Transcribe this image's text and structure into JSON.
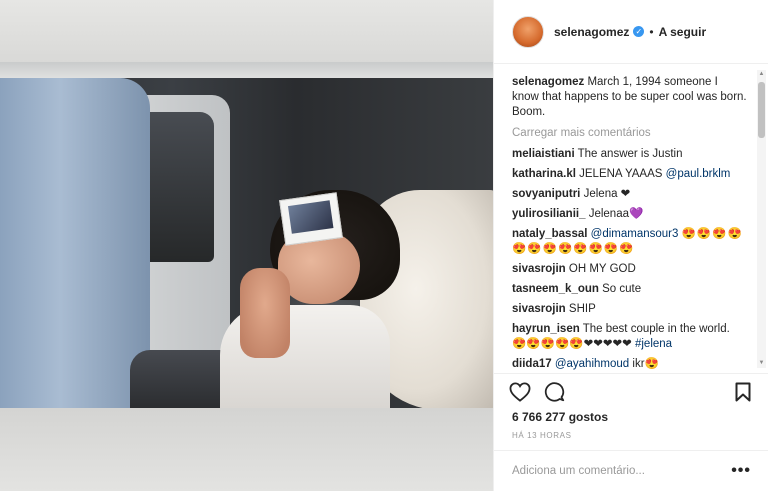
{
  "post": {
    "username": "selenagomez",
    "follow_separator": "•",
    "follow_label": "A seguir",
    "caption_user": "selenagomez",
    "caption_text": "March 1, 1994 someone I know that happens to be super cool was born. Boom.",
    "load_more": "Carregar mais comentários",
    "likes": "6 766 277 gostos",
    "time": "HÁ 13 HORAS",
    "add_comment_placeholder": "Adiciona um comentário...",
    "options_label": "•••"
  },
  "comments": [
    {
      "user": "meliaistiani",
      "text": "The answer is Justin"
    },
    {
      "user": "katharina.kl",
      "text": "JELENA YAAAS",
      "mention": "@paul.brklm"
    },
    {
      "user": "sovyaniputri",
      "text": "Jelena ❤"
    },
    {
      "user": "yulirosilianii_",
      "text": "Jelenaa💜"
    },
    {
      "user": "nataly_bassal",
      "mention": "@dimamansour3",
      "text": "😍😍😍😍😍😍😍😍😍😍😍😍"
    },
    {
      "user": "sivasrojin",
      "text": "OH MY GOD"
    },
    {
      "user": "tasneem_k_oun",
      "text": "So cute"
    },
    {
      "user": "sivasrojin",
      "text": "SHIP"
    },
    {
      "user": "hayrun_isen",
      "text": "The best couple in the world. 😍😍😍😍😍❤❤❤❤❤",
      "mention": "#jelena"
    },
    {
      "user": "diida17",
      "mention": "@ayahihmoud",
      "text": "ikr😍"
    }
  ],
  "icons": {
    "like": "heart-icon",
    "comment": "comment-bubble-icon",
    "save": "bookmark-icon",
    "verified": "verified-badge-icon"
  },
  "colors": {
    "verified": "#3897f0",
    "link": "#003569",
    "muted": "#999999"
  }
}
